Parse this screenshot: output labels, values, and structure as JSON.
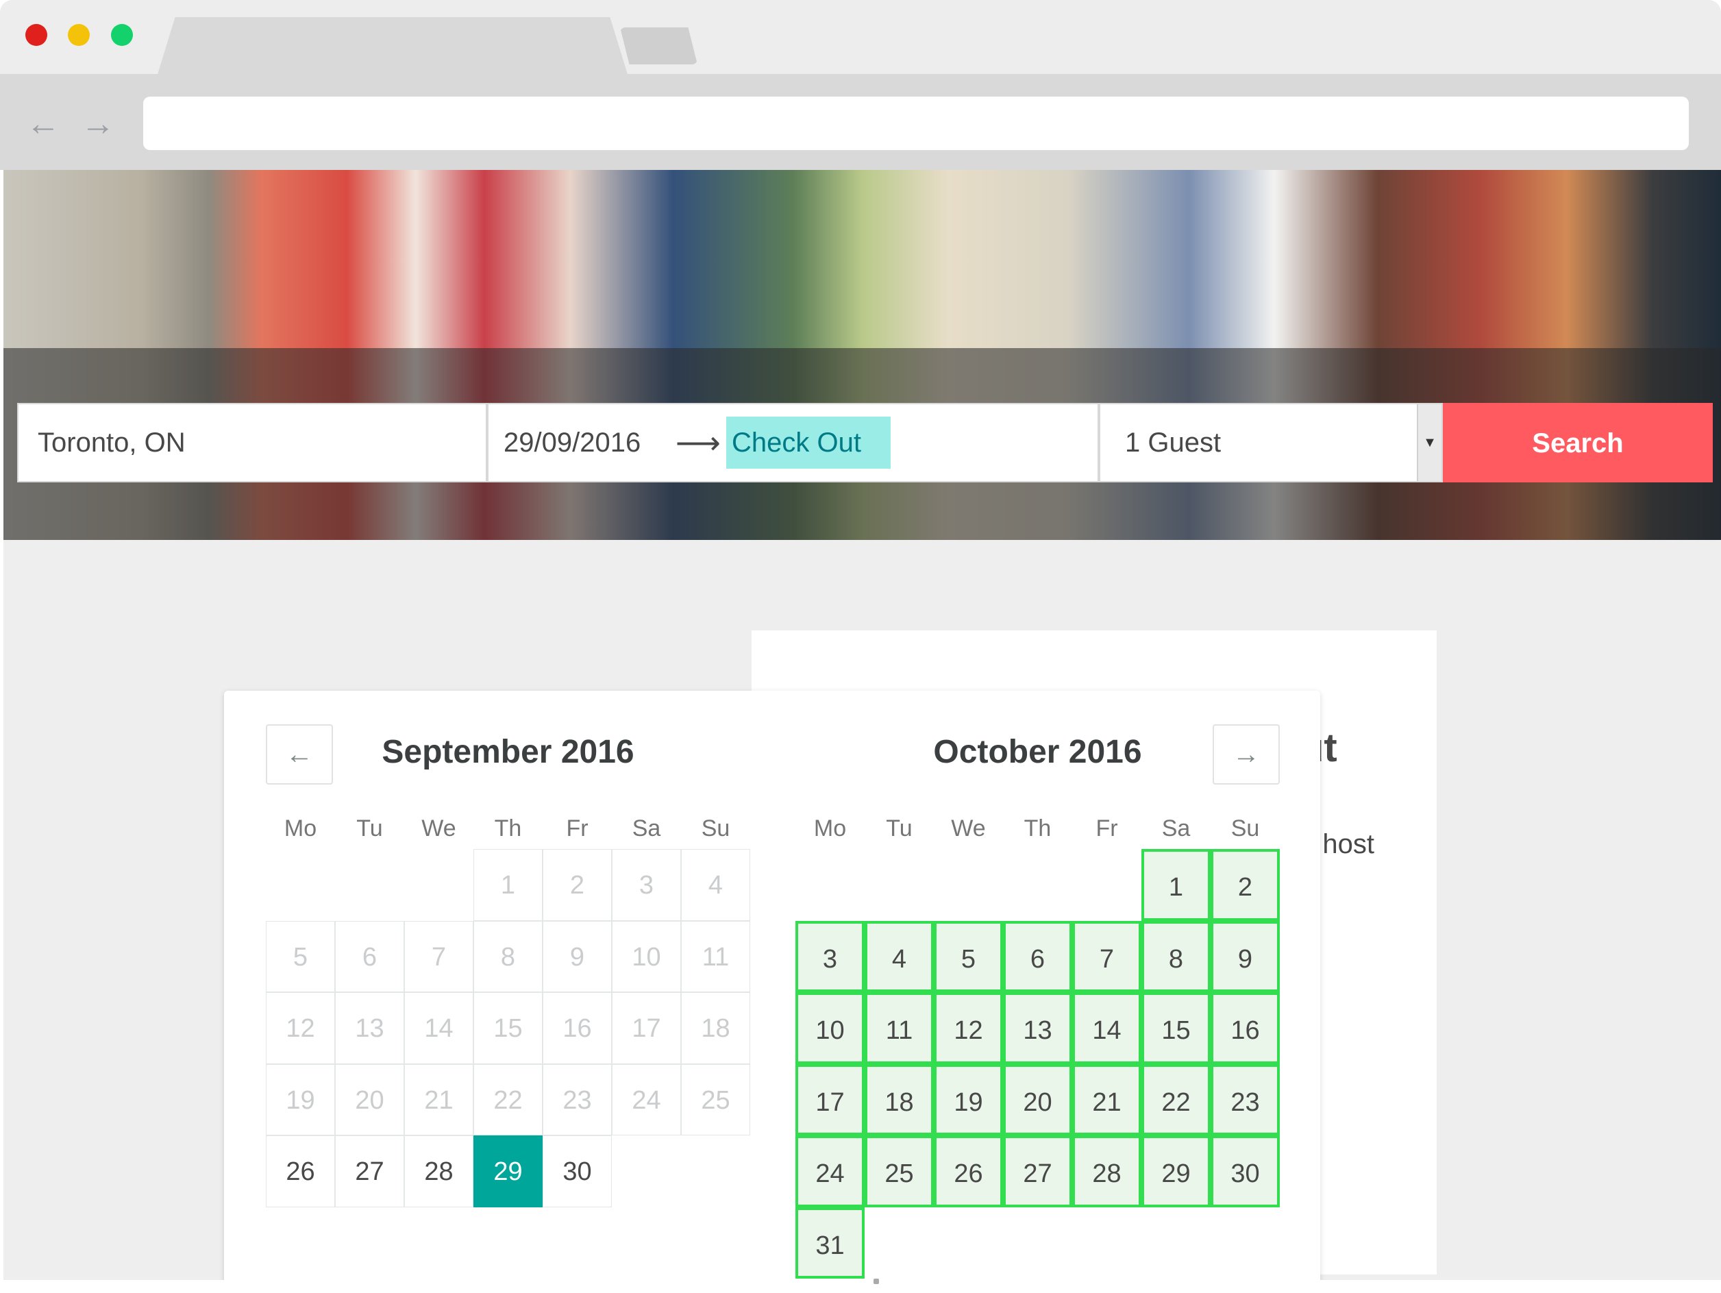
{
  "search": {
    "location": "Toronto, ON",
    "check_in": "29/09/2016",
    "arrow": "⟶",
    "check_out_placeholder": "Check Out",
    "guests": "1 Guest",
    "search_label": "Search"
  },
  "page": {
    "heading_fragment": "ut",
    "text_fragment": "n host"
  },
  "picker": {
    "prev_label": "←",
    "next_label": "→",
    "weekdays": [
      "Mo",
      "Tu",
      "We",
      "Th",
      "Fr",
      "Sa",
      "Su"
    ],
    "months": [
      {
        "title": "September 2016",
        "weeks": [
          [
            "",
            "",
            "",
            "1",
            "2",
            "3",
            "4"
          ],
          [
            "5",
            "6",
            "7",
            "8",
            "9",
            "10",
            "11"
          ],
          [
            "12",
            "13",
            "14",
            "15",
            "16",
            "17",
            "18"
          ],
          [
            "19",
            "20",
            "21",
            "22",
            "23",
            "24",
            "25"
          ],
          [
            "26",
            "27",
            "28",
            "29",
            "30",
            "",
            ""
          ]
        ]
      },
      {
        "title": "October 2016",
        "weeks": [
          [
            "",
            "",
            "",
            "",
            "",
            "1",
            "2"
          ],
          [
            "3",
            "4",
            "5",
            "6",
            "7",
            "8",
            "9"
          ],
          [
            "10",
            "11",
            "12",
            "13",
            "14",
            "15",
            "16"
          ],
          [
            "17",
            "18",
            "19",
            "20",
            "21",
            "22",
            "23"
          ],
          [
            "24",
            "25",
            "26",
            "27",
            "28",
            "29",
            "30"
          ],
          [
            "31",
            "",
            "",
            "",
            "",
            "",
            ""
          ]
        ]
      }
    ]
  },
  "colors": {
    "search_button": "#ff5a5f",
    "selected_day": "#00a699",
    "check_out_highlight": "#99ede6",
    "range_outline": "#33dd50"
  }
}
